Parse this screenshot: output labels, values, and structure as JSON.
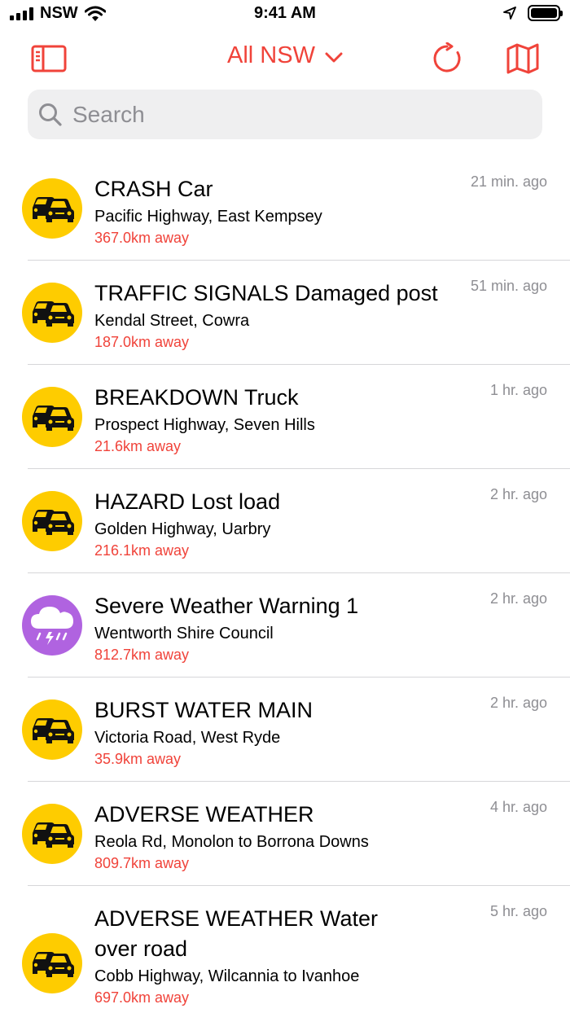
{
  "status_bar": {
    "carrier": "NSW",
    "time": "9:41 AM"
  },
  "nav": {
    "title": "All NSW",
    "accent_color": "#f0433a"
  },
  "search": {
    "placeholder": "Search"
  },
  "incidents": [
    {
      "title": "CRASH Car",
      "location": "Pacific Highway, East Kempsey",
      "distance": "367.0km away",
      "time": "21 min. ago",
      "icon": "traffic-cars-icon",
      "icon_color": "#fecc00"
    },
    {
      "title": "TRAFFIC SIGNALS Damaged post",
      "location": "Kendal Street, Cowra",
      "distance": "187.0km away",
      "time": "51 min. ago",
      "icon": "traffic-cars-icon",
      "icon_color": "#fecc00"
    },
    {
      "title": "BREAKDOWN Truck",
      "location": "Prospect Highway, Seven Hills",
      "distance": "21.6km away",
      "time": "1 hr. ago",
      "icon": "traffic-cars-icon",
      "icon_color": "#fecc00"
    },
    {
      "title": "HAZARD Lost load",
      "location": "Golden Highway, Uarbry",
      "distance": "216.1km away",
      "time": "2 hr. ago",
      "icon": "traffic-cars-icon",
      "icon_color": "#fecc00"
    },
    {
      "title": "Severe Weather Warning 1",
      "location": "Wentworth Shire Council",
      "distance": "812.7km away",
      "time": "2 hr. ago",
      "icon": "storm-cloud-icon",
      "icon_color": "#b063e0"
    },
    {
      "title": "BURST WATER MAIN",
      "location": "Victoria Road, West Ryde",
      "distance": "35.9km away",
      "time": "2 hr. ago",
      "icon": "traffic-cars-icon",
      "icon_color": "#fecc00"
    },
    {
      "title": "ADVERSE WEATHER",
      "location": "Reola Rd, Monolon to Borrona Downs",
      "distance": "809.7km away",
      "time": "4 hr. ago",
      "icon": "traffic-cars-icon",
      "icon_color": "#fecc00"
    },
    {
      "title": "ADVERSE WEATHER Water over road",
      "location": "Cobb Highway, Wilcannia to Ivanhoe",
      "distance": "697.0km away",
      "time": "5 hr. ago",
      "icon": "traffic-cars-icon",
      "icon_color": "#fecc00"
    }
  ]
}
